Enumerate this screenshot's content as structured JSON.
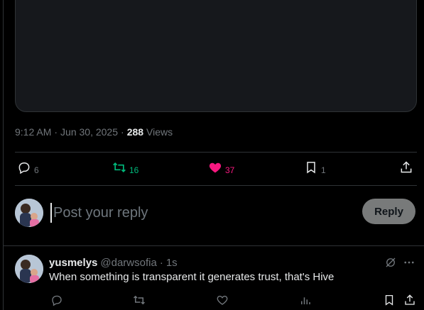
{
  "tweet": {
    "time": "9:12 AM",
    "date": "Jun 30, 2025",
    "views_count": "288",
    "views_label": "Views",
    "separator": "·"
  },
  "actions": {
    "replies": "6",
    "reposts": "16",
    "likes": "37",
    "bookmarks": "1"
  },
  "composer": {
    "placeholder": "Post your reply",
    "reply_button": "Reply"
  },
  "reply": {
    "name": "yusmelys",
    "handle": "@darwsofia",
    "separator": "·",
    "time": "1s",
    "text": "When something is transparent it generates trust, that's Hive"
  },
  "icons": {
    "reply": "reply-icon",
    "repost": "repost-icon",
    "like": "heart-filled-icon",
    "bookmark": "bookmark-icon",
    "share": "share-icon",
    "grok": "grok-icon",
    "more": "more-icon",
    "views": "views-chart-icon"
  },
  "colors": {
    "background": "#000000",
    "repost_active": "#00ba7c",
    "like_active": "#f91880",
    "muted": "#71767b",
    "reply_button_bg": "#787a7a"
  }
}
